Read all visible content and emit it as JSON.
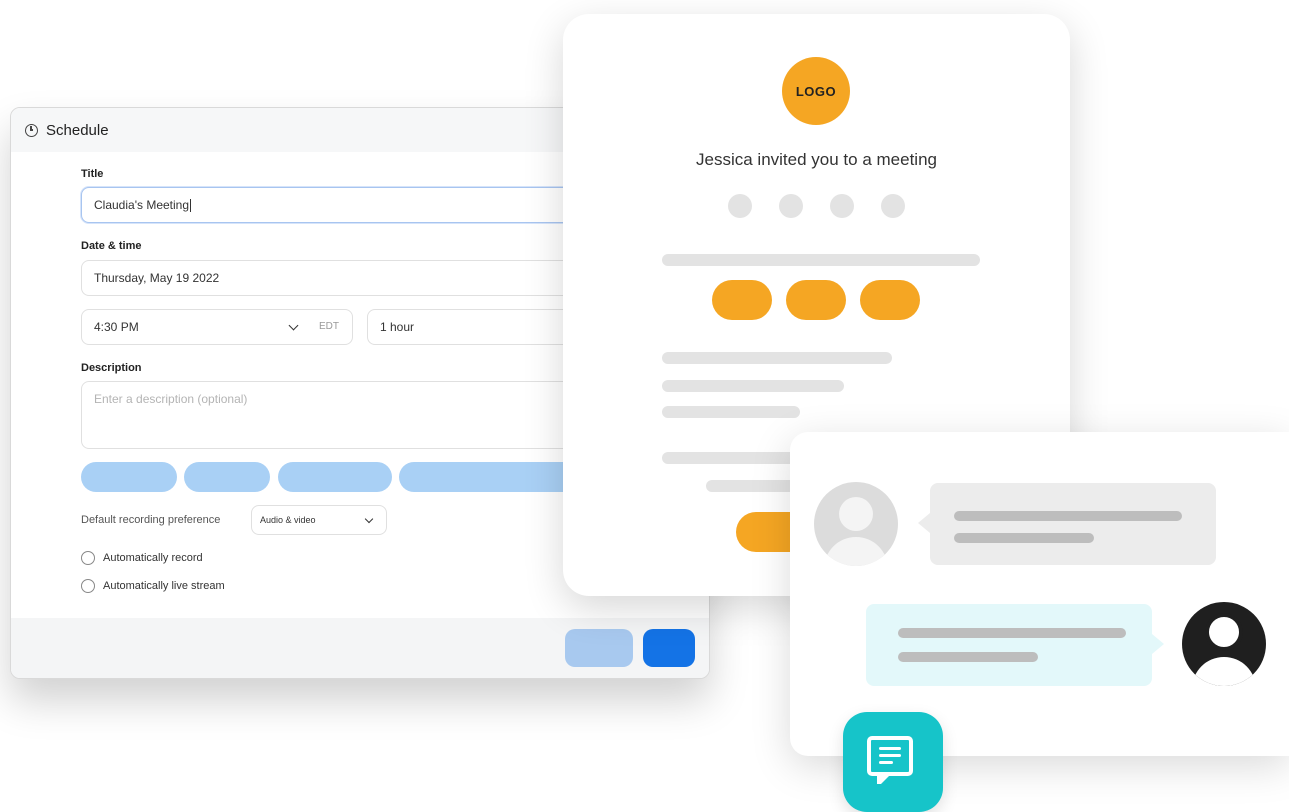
{
  "schedule": {
    "header_title": "Schedule",
    "title_label": "Title",
    "title_value": "Claudia's Meeting",
    "datetime_label": "Date & time",
    "date_value": "Thursday, May 19 2022",
    "time_value": "4:30 PM",
    "timezone": "EDT",
    "duration_value": "1 hour",
    "description_label": "Description",
    "description_placeholder": "Enter a description (optional)",
    "recording_pref_label": "Default recording preference",
    "recording_pref_value": "Audio & video",
    "auto_record_label": "Automatically record",
    "auto_livestream_label": "Automatically live stream"
  },
  "invite": {
    "logo_text": "LOGO",
    "title": "Jessica invited you to a meeting"
  },
  "colors": {
    "brand_orange": "#f5a623",
    "primary_blue": "#1473e6",
    "light_blue": "#a9d0f5",
    "chat_teal": "#16c4c9"
  },
  "icons": {
    "schedule_header": "clock-icon",
    "chat_fab": "chat-icon"
  }
}
